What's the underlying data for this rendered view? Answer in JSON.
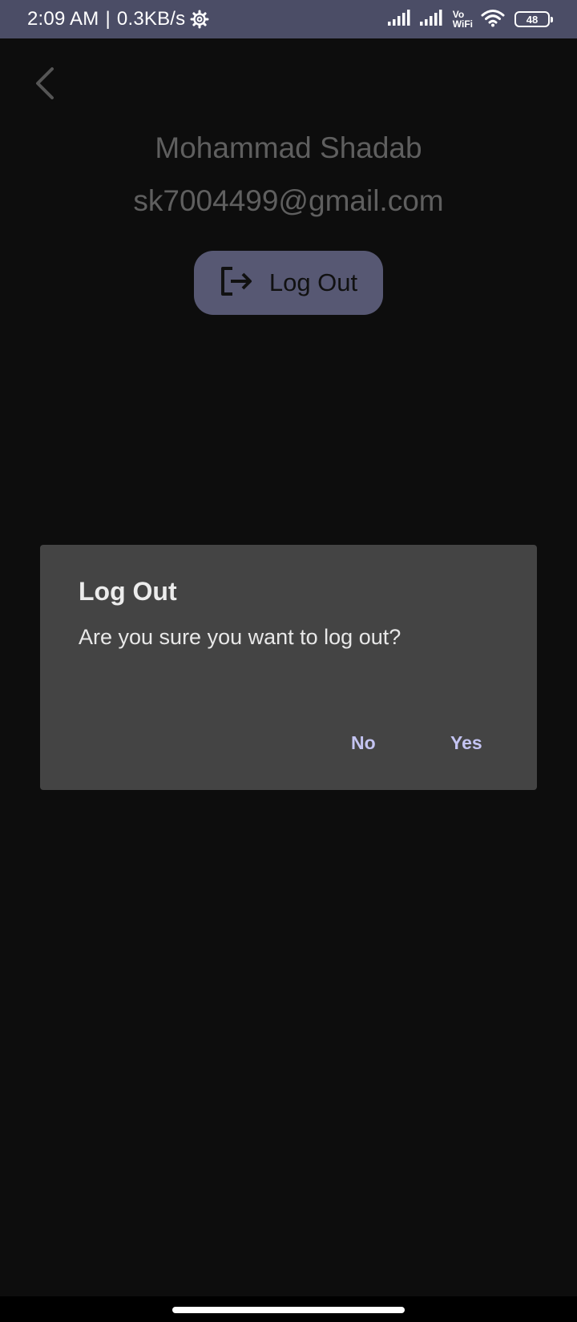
{
  "status_bar": {
    "time": "2:09 AM",
    "separator": "|",
    "speed": "0.3KB/s",
    "vo": "Vo",
    "wifi_label": "WiFi",
    "battery": "48",
    "icons": [
      "gear-icon",
      "signal-icon",
      "signal-icon",
      "vowifi-icon",
      "wifi-icon",
      "battery-icon"
    ]
  },
  "profile": {
    "name": "Mohammad Shadab",
    "email": "sk7004499@gmail.com",
    "logout_label": "Log Out"
  },
  "dialog": {
    "title": "Log Out",
    "message": "Are you sure you want to log out?",
    "no_label": "No",
    "yes_label": "Yes"
  },
  "colors": {
    "status_bar": "#4b4d66",
    "background": "#0d0d0d",
    "dialog": "#444444",
    "dialog_button": "#c4c4f2",
    "logout_button": "#575873"
  }
}
